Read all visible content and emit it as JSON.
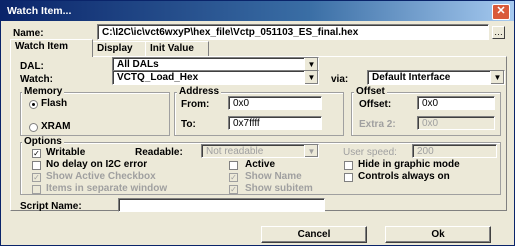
{
  "window": {
    "title": "Watch Item..."
  },
  "name": {
    "label": "Name:",
    "value": "C:\\I2C\\ic\\vct6wxyP\\hex_file\\Vctp_051103_ES_final.hex"
  },
  "tabs": [
    {
      "label": "Watch Item"
    },
    {
      "label": "Display"
    },
    {
      "label": "Init Value"
    }
  ],
  "dal": {
    "label": "DAL:",
    "value": "All DALs"
  },
  "watch": {
    "label": "Watch:",
    "value": "VCTQ_Load_Hex"
  },
  "via": {
    "label": "via:",
    "value": "Default Interface"
  },
  "memory": {
    "title": "Memory",
    "flash": "Flash",
    "xram": "XRAM",
    "selected": "Flash"
  },
  "address": {
    "title": "Address",
    "from_label": "From:",
    "from_value": "0x0",
    "to_label": "To:",
    "to_value": "0x7ffff"
  },
  "offset": {
    "title": "Offset",
    "offset_label": "Offset:",
    "offset_value": "0x0",
    "extra_label": "Extra 2:",
    "extra_value": "0x0"
  },
  "options": {
    "title": "Options",
    "writable": "Writable",
    "readable_label": "Readable:",
    "readable_value": "Not readable",
    "user_speed_label": "User speed:",
    "user_speed_value": "200",
    "no_delay": "No delay on I2C error",
    "active": "Active",
    "hide_graphic": "Hide in graphic mode",
    "show_active_checkbox": "Show Active Checkbox",
    "show_name": "Show Name",
    "controls_always_on": "Controls always on",
    "items_separate": "Items in separate window",
    "show_subitem": "Show subitem"
  },
  "script": {
    "label": "Script Name:",
    "value": ""
  },
  "buttons": {
    "cancel": "Cancel",
    "ok": "Ok"
  },
  "icons": {
    "close": "close-icon",
    "browse": "browse-icon",
    "check": "checkmark-icon"
  }
}
